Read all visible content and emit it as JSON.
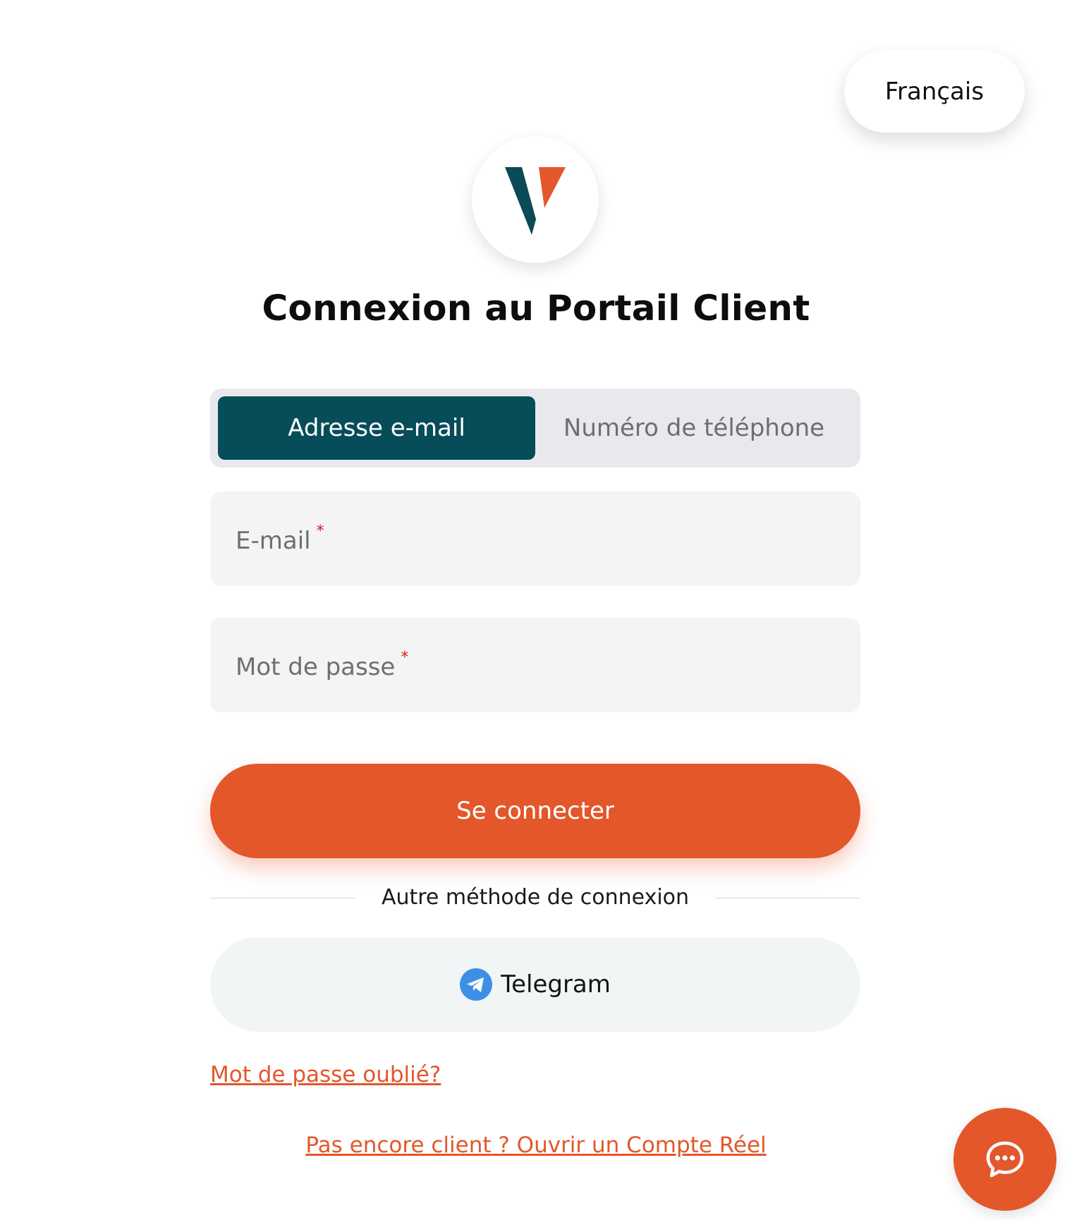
{
  "language": {
    "selected": "Français"
  },
  "logo": {
    "icon": "v-logo-icon",
    "colors": {
      "teal": "#0b4a57",
      "orange": "#e3572b"
    }
  },
  "title": "Connexion au Portail Client",
  "tabs": [
    {
      "label": "Adresse e-mail",
      "active": true
    },
    {
      "label": "Numéro de téléphone",
      "active": false
    }
  ],
  "form": {
    "email": {
      "label": "E-mail",
      "required_mark": "*"
    },
    "password": {
      "label": "Mot de passe",
      "required_mark": "*"
    },
    "submit_label": "Se connecter"
  },
  "alt_login": {
    "divider_text": "Autre méthode de connexion",
    "telegram_label": "Telegram",
    "telegram_icon": "telegram-icon"
  },
  "links": {
    "forgot_password": "Mot de passe oublié?",
    "signup": "Pas encore client ? Ouvrir un Compte Réel"
  },
  "chat": {
    "icon": "chat-bubble-icon"
  },
  "colors": {
    "accent": "#e3572b",
    "primary_dark": "#074c59",
    "field_bg": "#f4f4f5",
    "required": "#c72414"
  }
}
